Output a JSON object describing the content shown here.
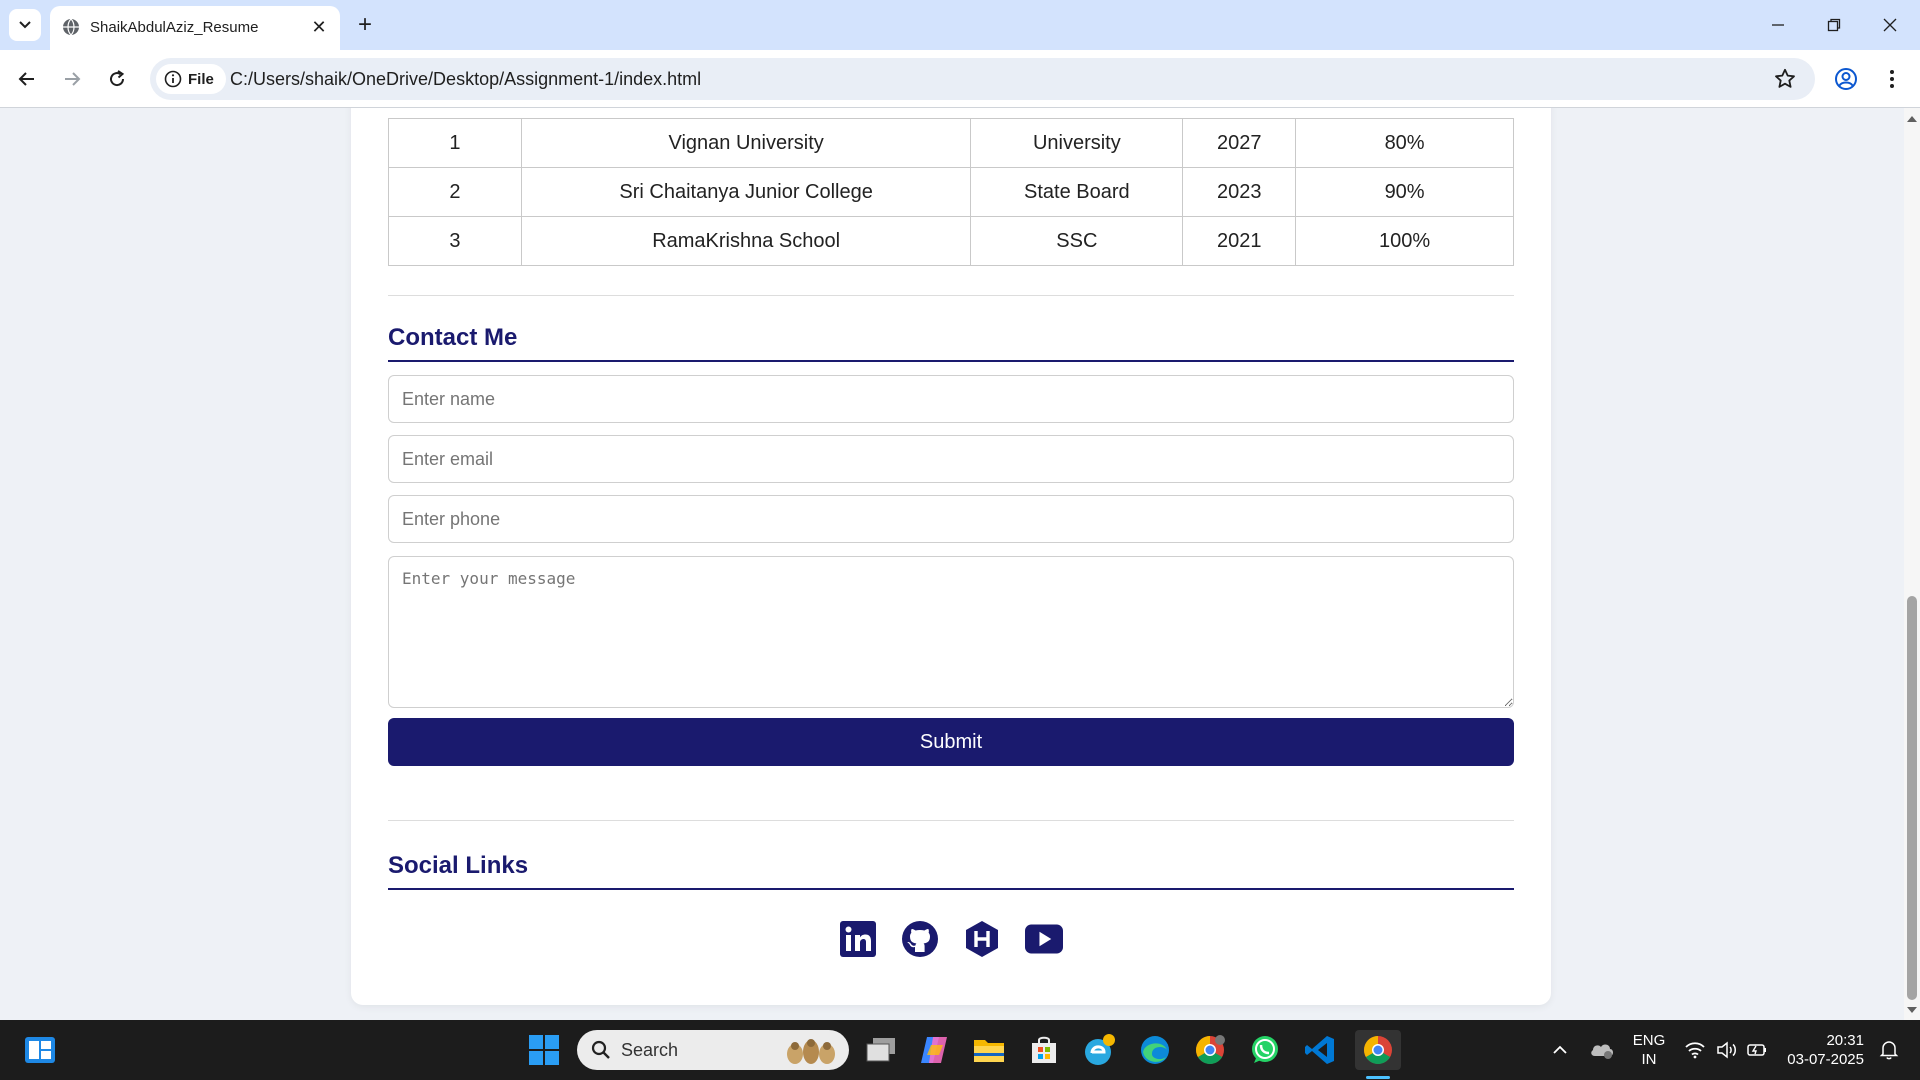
{
  "browser": {
    "tab_title": "ShaikAbdulAziz_Resume",
    "site_chip": "File",
    "url": "C:/Users/shaik/OneDrive/Desktop/Assignment-1/index.html"
  },
  "education": {
    "rows": [
      {
        "sno": "1",
        "institution": "Vignan University",
        "board": "University",
        "year": "2027",
        "score": "80%"
      },
      {
        "sno": "2",
        "institution": "Sri Chaitanya Junior College",
        "board": "State Board",
        "year": "2023",
        "score": "90%"
      },
      {
        "sno": "3",
        "institution": "RamaKrishna School",
        "board": "SSC",
        "year": "2021",
        "score": "100%"
      }
    ]
  },
  "contact": {
    "title": "Contact Me",
    "name_placeholder": "Enter name",
    "email_placeholder": "Enter email",
    "phone_placeholder": "Enter phone",
    "message_placeholder": "Enter your message",
    "submit_label": "Submit"
  },
  "social": {
    "title": "Social Links",
    "icons": [
      "linkedin-icon",
      "github-icon",
      "hashnode-icon",
      "youtube-icon"
    ]
  },
  "taskbar": {
    "search_placeholder": "Search",
    "language_top": "ENG",
    "language_bottom": "IN",
    "time": "20:31",
    "date": "03-07-2025"
  },
  "colors": {
    "accent": "#1a1a6e",
    "tabbar": "#d3e3fd"
  }
}
